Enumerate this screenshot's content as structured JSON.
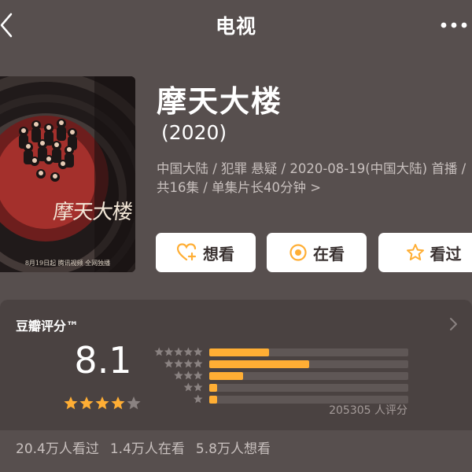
{
  "header": {
    "title": "电视"
  },
  "poster": {
    "art_title": "摩天大楼",
    "caption": "8月19日起 腾讯视频 全网独播"
  },
  "movie": {
    "title": "摩天大楼",
    "year": "(2020)",
    "meta": "中国大陆 / 犯罪 悬疑 / 2020-08-19(中国大陆) 首播 / 共16集 / 单集片长40分钟",
    "meta_chevron": ">"
  },
  "actions": {
    "want": "想看",
    "watching": "在看",
    "watched": "看过"
  },
  "rating": {
    "label": "豆瓣评分™",
    "score": "8.1",
    "star_value": 4,
    "star_max": 5,
    "count_text": "205305 人评分",
    "distribution": [
      {
        "stars": 5,
        "fraction": 0.3
      },
      {
        "stars": 4,
        "fraction": 0.5
      },
      {
        "stars": 3,
        "fraction": 0.17
      },
      {
        "stars": 2,
        "fraction": 0.04
      },
      {
        "stars": 1,
        "fraction": 0.04
      }
    ]
  },
  "stats": {
    "watched": "20.4万人看过",
    "watching": "1.4万人在看",
    "want": "5.8万人想看"
  },
  "colors": {
    "background": "#574f4e",
    "card": "#4a4241",
    "accent": "#ffae34",
    "star_gray": "#8a8281"
  },
  "icons": [
    "back-arrow-icon",
    "more-dots-icon",
    "heart-plus-icon",
    "target-icon",
    "star-outline-icon",
    "chevron-right-icon",
    "star-icon"
  ]
}
